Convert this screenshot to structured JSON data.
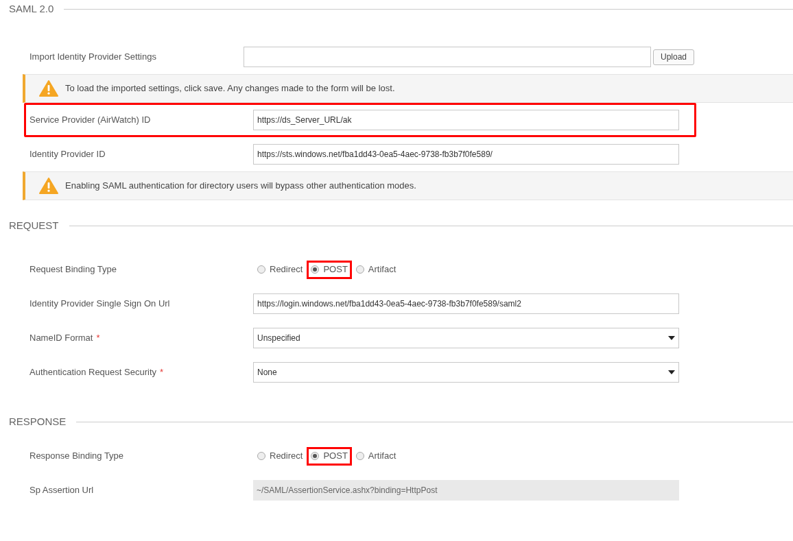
{
  "sections": [
    {
      "title": "SAML 2.0",
      "items": [
        {
          "kind": "file",
          "label": "Import Identity Provider Settings",
          "button": "Upload",
          "highlighted": false
        },
        {
          "kind": "alert",
          "text": "To load the imported settings, click save. Any changes made to the form will be lost."
        },
        {
          "kind": "text",
          "label": "Service Provider (AirWatch) ID",
          "value": "https://ds_Server_URL/ak",
          "highlighted": true
        },
        {
          "kind": "text",
          "label": "Identity Provider ID",
          "value": "https://sts.windows.net/fba1dd43-0ea5-4aec-9738-fb3b7f0fe589/",
          "highlighted": false
        },
        {
          "kind": "alert",
          "text": "Enabling SAML authentication for directory users will bypass other authentication modes."
        }
      ]
    },
    {
      "title": "REQUEST",
      "items": [
        {
          "kind": "radio",
          "label": "Request Binding Type",
          "options": [
            {
              "label": "Redirect",
              "selected": false,
              "highlighted": false
            },
            {
              "label": "POST",
              "selected": true,
              "highlighted": true
            },
            {
              "label": "Artifact",
              "selected": false,
              "highlighted": false
            }
          ]
        },
        {
          "kind": "text",
          "label": "Identity Provider Single Sign On Url",
          "value": "https://login.windows.net/fba1dd43-0ea5-4aec-9738-fb3b7f0fe589/saml2",
          "highlighted": false
        },
        {
          "kind": "select",
          "label": "NameID Format",
          "required_mark": "*",
          "value": "Unspecified"
        },
        {
          "kind": "select",
          "label": "Authentication Request Security",
          "required_mark": "*",
          "value": "None"
        }
      ]
    },
    {
      "title": "RESPONSE",
      "items": [
        {
          "kind": "radio",
          "label": "Response Binding Type",
          "options": [
            {
              "label": "Redirect",
              "selected": false,
              "highlighted": false
            },
            {
              "label": "POST",
              "selected": true,
              "highlighted": true
            },
            {
              "label": "Artifact",
              "selected": false,
              "highlighted": false
            }
          ]
        },
        {
          "kind": "readonly",
          "label": "Sp Assertion Url",
          "value": "~/SAML/AssertionService.ashx?binding=HttpPost"
        }
      ]
    }
  ]
}
